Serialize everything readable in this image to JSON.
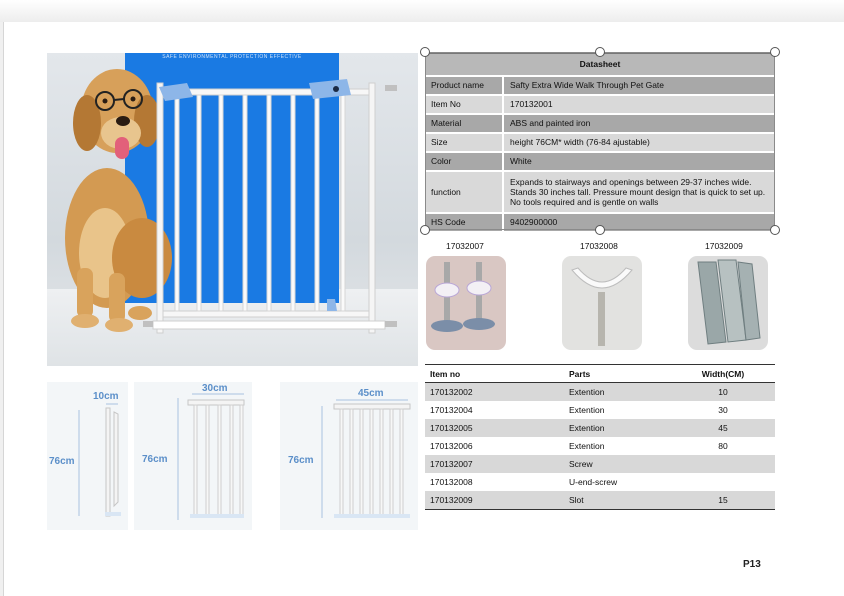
{
  "hero": {
    "banner": "SAFE ENVIRONMENTAL PROTECTION EFFECTIVE"
  },
  "diagrams": [
    {
      "height_label": "76cm",
      "width_label": "10cm"
    },
    {
      "height_label": "76cm",
      "width_label": "30cm"
    },
    {
      "height_label": "76cm",
      "width_label": "45cm"
    }
  ],
  "datasheet": {
    "title": "Datasheet",
    "rows": [
      {
        "key": "Product name",
        "value": "Safty Extra Wide Walk Through Pet Gate"
      },
      {
        "key": "Item No",
        "value": "170132001"
      },
      {
        "key": "Material",
        "value": "ABS and painted iron"
      },
      {
        "key": "Size",
        "value": "height 76CM* width (76-84 ajustable)"
      },
      {
        "key": "Color",
        "value": "White"
      },
      {
        "key": "function",
        "value": "Expands to stairways and openings between 29-37 inches wide. Stands 30 inches tall. Pressure mount design that is quick to set up. No tools required and is gentle on walls"
      },
      {
        "key": "HS Code",
        "value": "9402900000"
      }
    ]
  },
  "parts_images": [
    {
      "code": "17032007"
    },
    {
      "code": "17032008"
    },
    {
      "code": "17032009"
    }
  ],
  "parts_table": {
    "headers": [
      "Item no",
      "Parts",
      "Width(CM)"
    ],
    "rows": [
      [
        "170132002",
        "Extention",
        "10"
      ],
      [
        "170132004",
        "Extention",
        "30"
      ],
      [
        "170132005",
        "Extention",
        "45"
      ],
      [
        "170132006",
        "Extention",
        "80"
      ],
      [
        "170132007",
        "Screw",
        ""
      ],
      [
        "170132008",
        "U-end-screw",
        ""
      ],
      [
        "170132009",
        "Slot",
        "15"
      ]
    ]
  },
  "page_number": "P13",
  "colors": {
    "gate_blue": "#1a7ae3",
    "dimension_blue": "#5b8fc9",
    "table_dark": "#a8a8a8",
    "table_light": "#d9d9d9"
  }
}
